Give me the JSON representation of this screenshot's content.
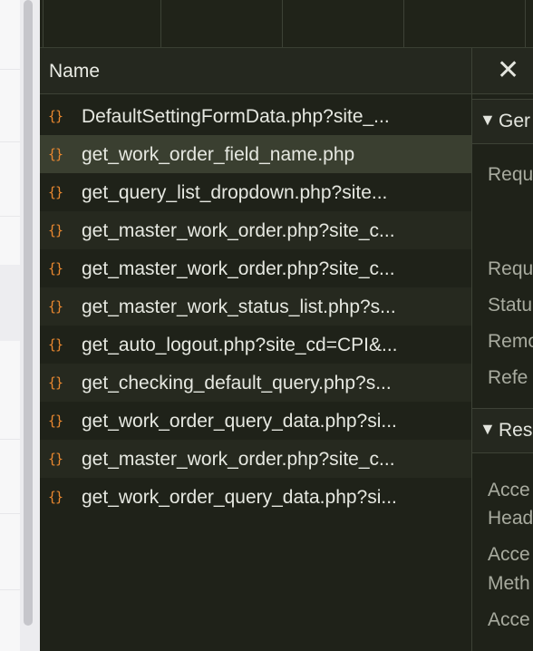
{
  "network": {
    "column_name": "Name",
    "requests": [
      {
        "name": "DefaultSettingFormData.php?site_..."
      },
      {
        "name": "get_work_order_field_name.php"
      },
      {
        "name": "get_query_list_dropdown.php?site..."
      },
      {
        "name": "get_master_work_order.php?site_c..."
      },
      {
        "name": "get_master_work_order.php?site_c..."
      },
      {
        "name": "get_master_work_status_list.php?s..."
      },
      {
        "name": "get_auto_logout.php?site_cd=CPI&..."
      },
      {
        "name": "get_checking_default_query.php?s..."
      },
      {
        "name": "get_work_order_query_data.php?si..."
      },
      {
        "name": "get_master_work_order.php?site_c..."
      },
      {
        "name": "get_work_order_query_data.php?si..."
      }
    ],
    "request_icon": "{}",
    "selected_index": 1
  },
  "details": {
    "close_symbol": "✕",
    "general": {
      "arrow": "▼",
      "title": "Ger"
    },
    "general_fields": [
      "Requ",
      "Requ",
      "Statu",
      "Remo",
      "Refe"
    ],
    "response": {
      "arrow": "▼",
      "title": "Res"
    },
    "response_fields": [
      "Acce",
      "Head",
      "Acce",
      "Meth",
      "Acce"
    ]
  },
  "colors": {
    "background": "#1f2219",
    "selected_row": "#3a3f30",
    "icon": "#e8872f",
    "text": "#e6e8e1"
  }
}
